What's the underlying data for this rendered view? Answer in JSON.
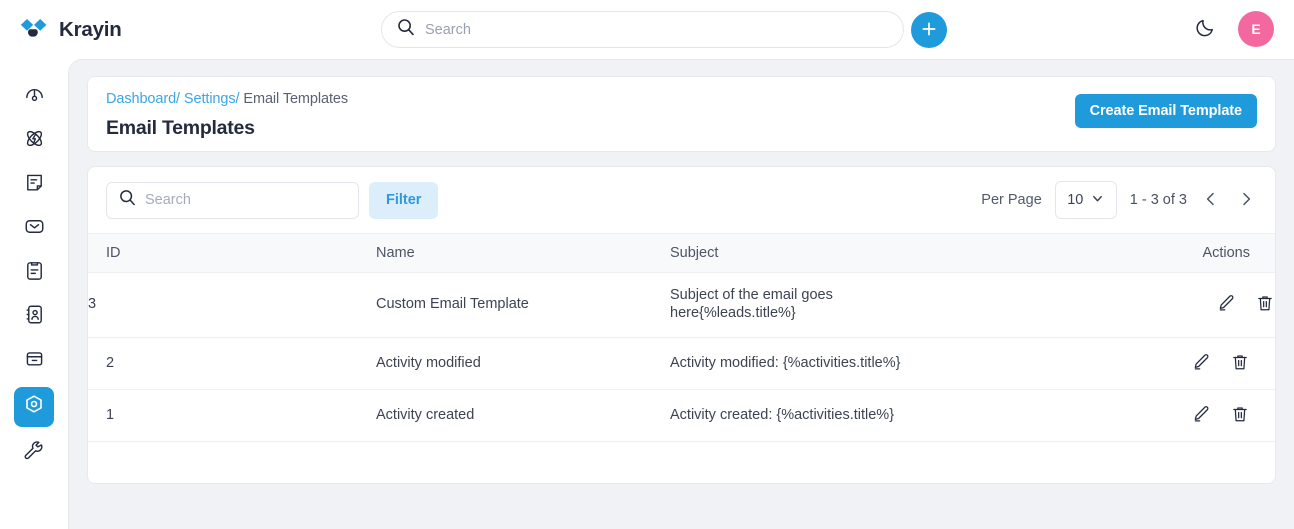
{
  "brand": {
    "name": "Krayin",
    "logo_icon": "krayin-logo-icon"
  },
  "topbar": {
    "search": {
      "placeholder": "Search",
      "value": "",
      "icon": "search-icon"
    },
    "add_button": {
      "icon": "plus-icon",
      "label": ""
    },
    "dark_mode_toggle": {
      "icon": "moon-icon"
    },
    "avatar": {
      "initial": "E"
    }
  },
  "sidebar": {
    "items": [
      {
        "name": "dashboard",
        "icon": "gauge-icon",
        "active": false
      },
      {
        "name": "leads",
        "icon": "atom-icon",
        "active": false
      },
      {
        "name": "quotes",
        "icon": "document-icon",
        "active": false
      },
      {
        "name": "mail",
        "icon": "envelope-icon",
        "active": false
      },
      {
        "name": "activities",
        "icon": "clipboard-icon",
        "active": false
      },
      {
        "name": "contacts",
        "icon": "address-book-icon",
        "active": false
      },
      {
        "name": "products",
        "icon": "box-icon",
        "active": false
      },
      {
        "name": "settings",
        "icon": "hexagon-gear-icon",
        "active": true
      },
      {
        "name": "configuration",
        "icon": "wrench-icon",
        "active": false
      }
    ]
  },
  "breadcrumb": {
    "dashboard": "Dashboard",
    "sep1": "/",
    "settings": "Settings",
    "sep2": "/",
    "current": "Email Templates"
  },
  "page": {
    "title": "Email Templates",
    "create_button": "Create Email Template"
  },
  "toolbar": {
    "search": {
      "placeholder": "Search",
      "value": "",
      "icon": "search-icon"
    },
    "filter_label": "Filter"
  },
  "pagination": {
    "per_page_label": "Per Page",
    "per_page_value": "10",
    "range_text": "1 - 3 of 3",
    "prev_icon": "chevron-left-icon",
    "next_icon": "chevron-right-icon"
  },
  "table": {
    "columns": {
      "id": "ID",
      "name": "Name",
      "subject": "Subject",
      "actions": "Actions"
    },
    "rows": [
      {
        "id": "3",
        "name": "Custom Email Template",
        "subject": "Subject of the email goes here{%leads.title%}"
      },
      {
        "id": "2",
        "name": "Activity modified",
        "subject": "Activity modified: {%activities.title%}"
      },
      {
        "id": "1",
        "name": "Activity created",
        "subject": "Activity created: {%activities.title%}"
      }
    ],
    "row_actions": {
      "edit_icon": "pencil-icon",
      "delete_icon": "trash-icon"
    }
  },
  "colors": {
    "accent": "#1f9ada",
    "link": "#3ba6e8",
    "avatar": "#f3699f",
    "filter_bg": "#ddeefb",
    "page_bg": "#f1f2f6",
    "dark_text": "#242b3d"
  }
}
